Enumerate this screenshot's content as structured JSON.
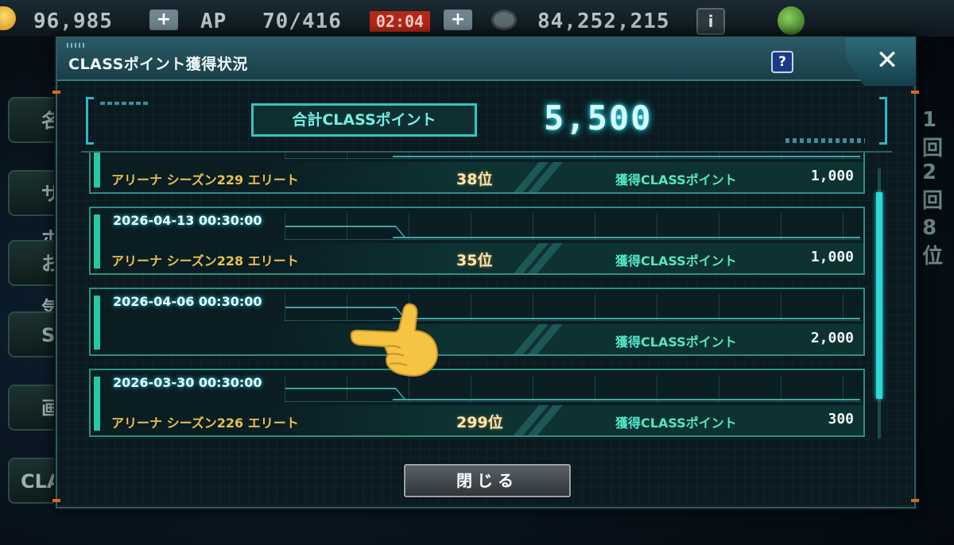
{
  "status_bar": {
    "stamina": "96,985",
    "ap_label": "AP",
    "ap_value": "70/416",
    "timer": "02:04",
    "money": "84,252,215",
    "plus_label": "+",
    "info_label": "i"
  },
  "background_menu": {
    "left_items": [
      "名",
      "サポ",
      "お気",
      "S",
      "画",
      "CLA"
    ],
    "right_items": [
      "1回",
      "2回",
      "8位"
    ]
  },
  "dialog": {
    "title": "CLASSポイント獲得状況",
    "help_label": "?",
    "close_label": "✕",
    "total_label": "合計CLASSポイント",
    "total_value": "5,500",
    "close_button_label": "閉じる"
  },
  "entries": [
    {
      "date": "",
      "name": "アリーナ シーズン229 エリート",
      "rank": "38位",
      "points_label": "獲得CLASSポイント",
      "points": "1,000"
    },
    {
      "date": "2026-04-13 00:30:00",
      "name": "アリーナ シーズン228 エリート",
      "rank": "35位",
      "points_label": "獲得CLASSポイント",
      "points": "1,000"
    },
    {
      "date": "2026-04-06 00:30:00",
      "name": "",
      "rank": "",
      "points_label": "獲得CLASSポイント",
      "points": "2,000"
    },
    {
      "date": "2026-03-30 00:30:00",
      "name": "アリーナ シーズン226 エリート",
      "rank": "299位",
      "points_label": "獲得CLASSポイント",
      "points": "300"
    }
  ],
  "colors": {
    "accent_cyan": "#2fd9d9",
    "name_gold": "#e9c14a",
    "points_green": "#55e6c8",
    "timer_red": "#b52717"
  },
  "icons": [
    "stamina-orb-icon",
    "plus-icon",
    "coin-icon",
    "info-icon",
    "avatar-icon",
    "help-icon",
    "close-icon",
    "pointing-hand-emoji"
  ]
}
